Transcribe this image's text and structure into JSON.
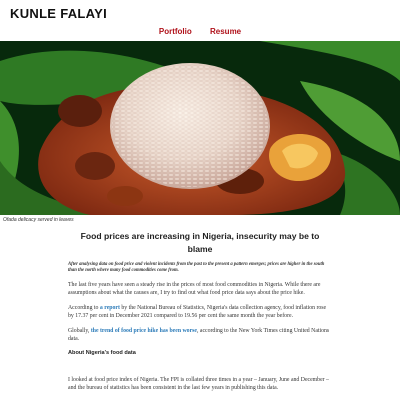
{
  "site": {
    "title": "KUNLE FALAYI"
  },
  "nav": {
    "items": [
      {
        "label": "Portfolio"
      },
      {
        "label": "Resume"
      }
    ]
  },
  "hero": {
    "caption": "Ofada delicacy served in leaves"
  },
  "article": {
    "headline": "Food prices are increasing in Nigeria, insecurity may be to blame",
    "standfirst": "After analysing data on food price and violent incidents from the past to the present a pattern emerges; prices are higher in the south than the north where many food commodities come from.",
    "p1": "The last five years have seen a steady rise in the prices of most food commodities in Nigeria. While there are assumptions about what the causes are, I try to find out what food price data says about the price hike.",
    "p2_pre": "According to ",
    "p2_link": "a report",
    "p2_post": " by the National Bureau of Statistics, Nigeria's data collection agency, food inflation rose by 17.37 per cent in December 2021 compared to 19.56 per cent the same month the year before.",
    "p3_pre": "Globally, ",
    "p3_link": "the trend of food price hike has been worse",
    "p3_post": ", according to the New York Times citing United Nations data.",
    "subhead": "About Nigeria's food data",
    "p4": "I looked at food price index of Nigeria. The FPI is collated three times in a year – January, June and December – and the bureau of statistics has been consistent in the last few years in publishing this data."
  }
}
